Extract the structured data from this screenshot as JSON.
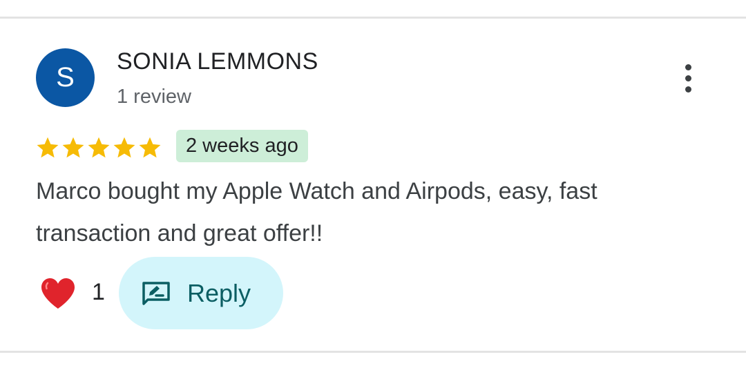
{
  "colors": {
    "avatar_bg": "#0b57a4",
    "star": "#f6bb06",
    "badge_bg": "#cdeed8",
    "reply_bg": "#d3f5fb",
    "heart": "#e0242c",
    "reply_text": "#0b5e63"
  },
  "review": {
    "avatar_initial": "S",
    "reviewer_name": "SONIA LEMMONS",
    "review_count": "1 review",
    "rating": 5,
    "rating_max": 5,
    "time_ago": "2 weeks ago",
    "text": "Marco bought my Apple Watch and Airpods, easy, fast transaction and great offer!!",
    "icons": {
      "more": "more-vert-icon",
      "star": "star-icon",
      "heart": "heart-icon",
      "reply": "rate-review-icon"
    }
  },
  "actions": {
    "like_count": "1",
    "reply_label": "Reply"
  }
}
